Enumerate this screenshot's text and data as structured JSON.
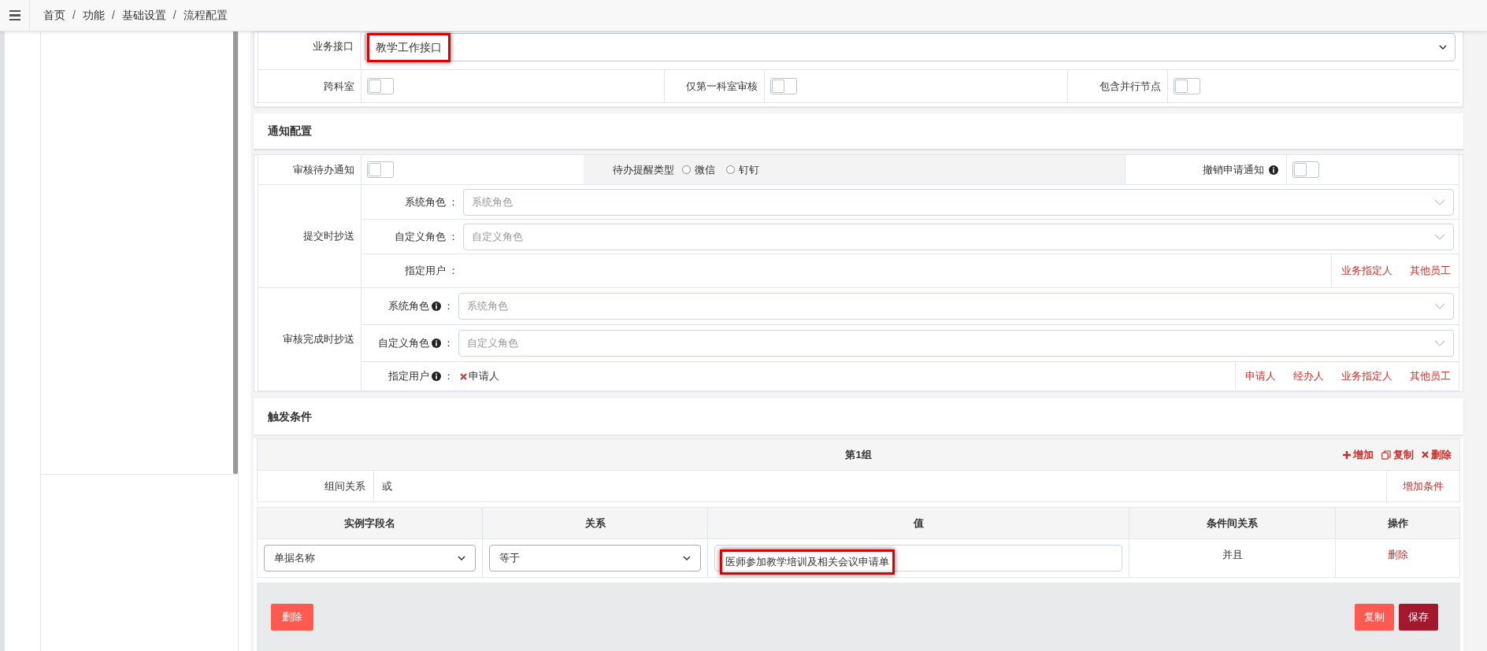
{
  "breadcrumb": [
    {
      "kind": "link",
      "text": "首页"
    },
    {
      "kind": "separator",
      "text": "/"
    },
    {
      "kind": "link",
      "text": "功能"
    },
    {
      "kind": "separator",
      "text": "/"
    },
    {
      "kind": "link",
      "text": "基础设置"
    },
    {
      "kind": "separator",
      "text": "/"
    },
    {
      "kind": "current",
      "text": "流程配置"
    }
  ],
  "basic": {
    "interface": {
      "label": "业务接口",
      "value": "教学工作接口",
      "highlighted": true
    },
    "toggles": [
      {
        "label": "跨科室",
        "on": false
      },
      {
        "label": "仅第一科室审核",
        "on": false
      },
      {
        "label": "包含并行节点",
        "on": false
      }
    ]
  },
  "notification": {
    "title": "通知配置",
    "pending_notice": {
      "label": "审核待办通知",
      "on": false
    },
    "reminder_type": {
      "label": "待办提醒类型",
      "options": [
        {
          "label": "微信",
          "selected": false
        },
        {
          "label": "钉钉",
          "selected": false
        }
      ]
    },
    "cancel_notice": {
      "label": "撤销申请通知",
      "info": true,
      "on": false
    },
    "cc_groups": [
      {
        "label": "提交时抄送",
        "rows": [
          {
            "kind": "select",
            "label": "系统角色",
            "colon": "：",
            "placeholder": "系统角色"
          },
          {
            "kind": "select",
            "label": "自定义角色",
            "colon": "：",
            "placeholder": "自定义角色"
          },
          {
            "kind": "users",
            "label": "指定用户",
            "colon": "：",
            "links": [
              "业务指定人",
              "其他员工"
            ]
          }
        ]
      },
      {
        "label": "审核完成时抄送",
        "rows": [
          {
            "kind": "select",
            "label": "系统角色",
            "info": true,
            "colon": "：",
            "placeholder": "系统角色"
          },
          {
            "kind": "select",
            "label": "自定义角色",
            "info": true,
            "colon": "：",
            "placeholder": "自定义角色"
          },
          {
            "kind": "users",
            "label": "指定用户",
            "info": true,
            "colon": "：",
            "users": [
              {
                "name": "申请人",
                "removable": true
              }
            ],
            "links": [
              "申请人",
              "经办人",
              "业务指定人",
              "其他员工"
            ]
          }
        ]
      }
    ]
  },
  "trigger": {
    "title": "触发条件",
    "groups": [
      {
        "title": "第1组",
        "actions": [
          {
            "kind": "add",
            "label": "增加"
          },
          {
            "kind": "copy",
            "label": "复制"
          },
          {
            "kind": "delete",
            "label": "删除"
          }
        ],
        "relation_label": "组间关系",
        "relation_value": "或",
        "add_condition": "增加条件",
        "columns": [
          "实例字段名",
          "关系",
          "值",
          "条件间关系",
          "操作"
        ],
        "rows": [
          {
            "field": "单据名称",
            "operator": "等于",
            "value": "医师参加教学培训及相关会议申请单",
            "value_highlighted": true,
            "logic": "并且",
            "action": "删除"
          }
        ]
      }
    ],
    "footer": {
      "delete": "删除",
      "copy": "复制",
      "save": "保存"
    }
  }
}
